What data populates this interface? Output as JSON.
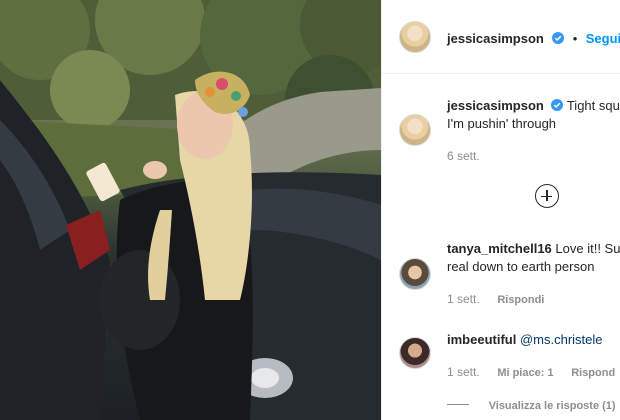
{
  "post": {
    "author": "jessicasimpson",
    "follow_label": "Segui",
    "separator": "•",
    "caption_line1": "Tight squ",
    "caption_line2": "I'm pushin' through",
    "caption_age": "6 sett."
  },
  "comments": [
    {
      "user": "tanya_mitchell16",
      "text_line1": "Love it!! Su",
      "text_line2": "real down to earth person",
      "age": "1 sett.",
      "reply_label": "Rispondi"
    },
    {
      "user": "imbeeutiful",
      "mention": "@ms.christele",
      "age": "1 sett.",
      "likes_label": "Mi piace: 1",
      "reply_label": "Rispond",
      "view_replies": "Visualizza le risposte (1)"
    }
  ],
  "colors": {
    "link": "#0095f6",
    "verified": "#3897f0",
    "meta": "#8e8e8e"
  },
  "icons": [
    "verified-badge-icon",
    "load-more-comments-icon"
  ]
}
